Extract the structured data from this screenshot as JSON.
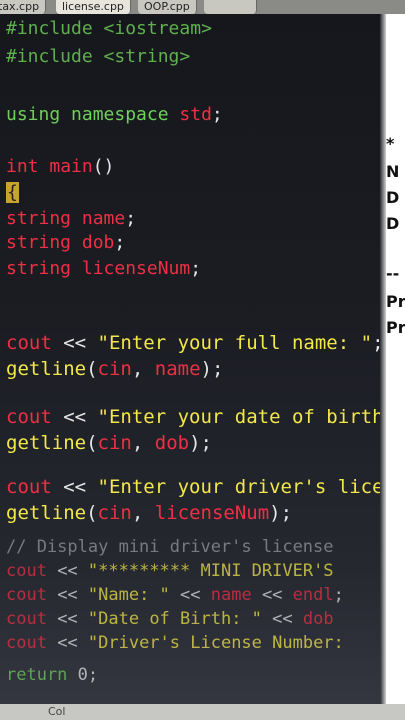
{
  "tabs": [
    "tax.cpp",
    "license.cpp",
    "OOP.cpp",
    ""
  ],
  "editor": {
    "lines": [
      {
        "style": "",
        "tokens": [
          {
            "t": "#include <iostream>",
            "c": "k-pre"
          }
        ]
      },
      {
        "style": "",
        "tokens": [
          {
            "t": "#include <string>",
            "c": "k-pre"
          }
        ]
      },
      {
        "style": "",
        "tokens": [
          {
            "t": "using namespace ",
            "c": "k-grn"
          },
          {
            "t": "std",
            "c": "k-red"
          },
          {
            "t": ";",
            "c": "k-wht"
          }
        ]
      },
      {
        "style": "",
        "tokens": [
          {
            "t": "int ",
            "c": "k-red"
          },
          {
            "t": "main",
            "c": "k-red"
          },
          {
            "t": "()",
            "c": "k-wht"
          }
        ]
      },
      {
        "style": "",
        "tokens": [
          {
            "t": "{",
            "c": "k-wht cursor-brace"
          }
        ]
      },
      {
        "style": "",
        "tokens": [
          {
            "t": "string ",
            "c": "k-red"
          },
          {
            "t": "name",
            "c": "k-red"
          },
          {
            "t": ";",
            "c": "k-wht"
          }
        ]
      },
      {
        "style": "",
        "tokens": [
          {
            "t": "string ",
            "c": "k-red"
          },
          {
            "t": "dob",
            "c": "k-red"
          },
          {
            "t": ";",
            "c": "k-wht"
          }
        ]
      },
      {
        "style": "",
        "tokens": [
          {
            "t": "string ",
            "c": "k-red"
          },
          {
            "t": "licenseNum",
            "c": "k-red"
          },
          {
            "t": ";",
            "c": "k-wht"
          }
        ]
      },
      {
        "style": "big",
        "tokens": [
          {
            "t": "cout ",
            "c": "k-red"
          },
          {
            "t": "<< ",
            "c": "k-wht"
          },
          {
            "t": "\"Enter your full name: \"",
            "c": "k-yel"
          },
          {
            "t": ";",
            "c": "k-wht"
          }
        ]
      },
      {
        "style": "big",
        "tokens": [
          {
            "t": "getline",
            "c": "k-yel"
          },
          {
            "t": "(",
            "c": "k-wht"
          },
          {
            "t": "cin",
            "c": "k-red"
          },
          {
            "t": ", ",
            "c": "k-wht"
          },
          {
            "t": "name",
            "c": "k-red"
          },
          {
            "t": ");",
            "c": "k-wht"
          }
        ]
      },
      {
        "style": "big",
        "tokens": [
          {
            "t": "cout ",
            "c": "k-red"
          },
          {
            "t": "<< ",
            "c": "k-wht"
          },
          {
            "t": "\"Enter your date of birth",
            "c": "k-yel"
          }
        ]
      },
      {
        "style": "big",
        "tokens": [
          {
            "t": "getline",
            "c": "k-yel"
          },
          {
            "t": "(",
            "c": "k-wht"
          },
          {
            "t": "cin",
            "c": "k-red"
          },
          {
            "t": ", ",
            "c": "k-wht"
          },
          {
            "t": "dob",
            "c": "k-red"
          },
          {
            "t": ");",
            "c": "k-wht"
          }
        ]
      },
      {
        "style": "big",
        "tokens": [
          {
            "t": "cout ",
            "c": "k-red"
          },
          {
            "t": "<< ",
            "c": "k-wht"
          },
          {
            "t": "\"Enter your driver's licen",
            "c": "k-yel"
          }
        ]
      },
      {
        "style": "big",
        "tokens": [
          {
            "t": "getline",
            "c": "k-yel"
          },
          {
            "t": "(",
            "c": "k-wht"
          },
          {
            "t": "cin",
            "c": "k-red"
          },
          {
            "t": ", ",
            "c": "k-wht"
          },
          {
            "t": "licenseNum",
            "c": "k-red"
          },
          {
            "t": ");",
            "c": "k-wht"
          }
        ]
      },
      {
        "style": "faded",
        "tokens": [
          {
            "t": "// Display mini driver's license",
            "c": "k-gry"
          }
        ]
      },
      {
        "style": "faded",
        "tokens": [
          {
            "t": "cout ",
            "c": "k-red"
          },
          {
            "t": "<< ",
            "c": "k-wht"
          },
          {
            "t": "\"********* MINI DRIVER'S",
            "c": "k-yel"
          }
        ]
      },
      {
        "style": "faded",
        "tokens": [
          {
            "t": "cout ",
            "c": "k-red"
          },
          {
            "t": "<< ",
            "c": "k-wht"
          },
          {
            "t": "\"Name: \" ",
            "c": "k-yel"
          },
          {
            "t": "<< ",
            "c": "k-wht"
          },
          {
            "t": "name ",
            "c": "k-red"
          },
          {
            "t": "<< ",
            "c": "k-wht"
          },
          {
            "t": "endl",
            "c": "k-red"
          },
          {
            "t": ";",
            "c": "k-wht"
          }
        ]
      },
      {
        "style": "faded",
        "tokens": [
          {
            "t": "cout ",
            "c": "k-red"
          },
          {
            "t": "<< ",
            "c": "k-wht"
          },
          {
            "t": "\"Date of Birth: \" ",
            "c": "k-yel"
          },
          {
            "t": "<< ",
            "c": "k-wht"
          },
          {
            "t": "dob",
            "c": "k-red"
          }
        ]
      },
      {
        "style": "faded",
        "tokens": [
          {
            "t": "cout ",
            "c": "k-red"
          },
          {
            "t": "<< ",
            "c": "k-wht"
          },
          {
            "t": "\"Driver's License Number:",
            "c": "k-yel"
          }
        ]
      },
      {
        "style": "faded",
        "tokens": [
          {
            "t": "return ",
            "c": "k-grn"
          },
          {
            "t": "0",
            "c": "k-wht"
          },
          {
            "t": ";",
            "c": "k-wht"
          }
        ]
      }
    ]
  },
  "right_panel": {
    "lines": [
      "*",
      "N",
      "D",
      "D",
      "--",
      "Pr",
      "Pr"
    ]
  },
  "statusbar": {
    "left": "Col"
  },
  "colors": {
    "preprocessor": "#60b04e",
    "keyword": "#ef2f45",
    "string": "#f3e84a",
    "comment": "#9a9aa0",
    "background": "#15171c"
  }
}
